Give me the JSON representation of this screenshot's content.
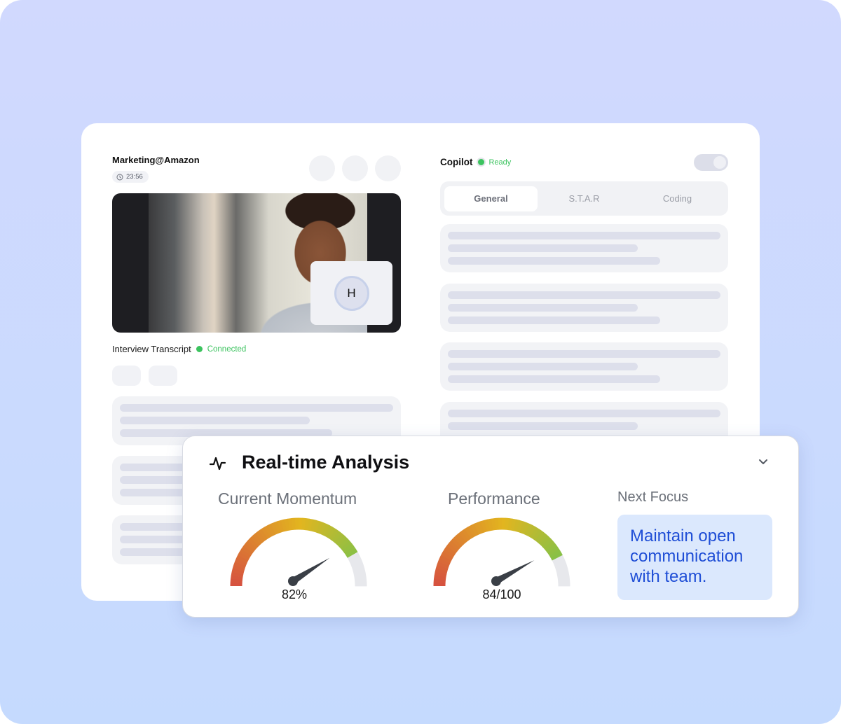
{
  "meeting": {
    "title": "Marketing@Amazon",
    "timer": "23:56",
    "timer_icon": "clock-icon",
    "action_buttons": [
      "circle-button-1",
      "circle-button-2",
      "circle-button-3"
    ],
    "video": {
      "self_avatar_initial": "H"
    },
    "transcript": {
      "label": "Interview Transcript",
      "status": "Connected",
      "status_color": "#3cc35f"
    }
  },
  "copilot": {
    "title": "Copilot",
    "status": "Ready",
    "status_color": "#3cc35f",
    "toggle_on": true,
    "tabs": [
      {
        "label": "General",
        "active": true
      },
      {
        "label": "S.T.A.R",
        "active": false
      },
      {
        "label": "Coding",
        "active": false
      }
    ]
  },
  "analysis": {
    "title": "Real-time Analysis",
    "title_icon": "activity-pulse-icon",
    "collapse_icon": "chevron-down-icon",
    "gauges": [
      {
        "label": "Current Momentum",
        "value": 82,
        "max": 100,
        "display": "82%"
      },
      {
        "label": "Performance",
        "value": 84,
        "max": 100,
        "display": "84/100"
      }
    ],
    "next_focus": {
      "label": "Next Focus",
      "text": "Maintain open communication with team."
    }
  },
  "colors": {
    "background_top": "#d1d9fe",
    "background_bottom": "#c5dafe",
    "focus_text": "#1f4ed6",
    "focus_bg": "#dbe8fd",
    "gauge_start": "#d6523f",
    "gauge_mid": "#e2b51f",
    "gauge_end": "#5cc65a",
    "gauge_track": "#e7e8ec",
    "needle": "#3a3f46"
  }
}
